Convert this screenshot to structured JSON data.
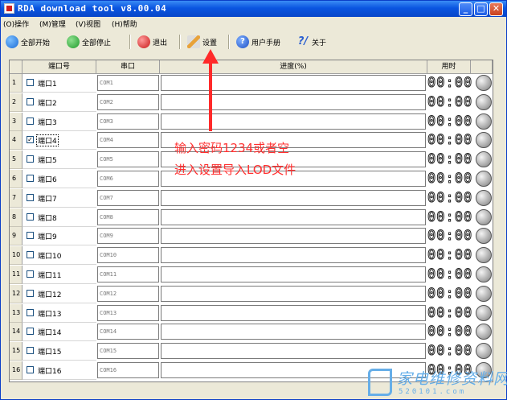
{
  "window": {
    "title": "RDA download tool v8.00.04",
    "min_glyph": "_",
    "max_glyph": "□",
    "close_glyph": "✕"
  },
  "menu": [
    {
      "label": "(O)操作"
    },
    {
      "label": "(M)管理"
    },
    {
      "label": "(V)视图"
    },
    {
      "label": "(H)帮助"
    }
  ],
  "toolbar": {
    "start_all": "全部开始",
    "stop_all": "全部停止",
    "exit": "退出",
    "settings": "设置",
    "manual": "用户手册",
    "about": "关于"
  },
  "grid": {
    "headers": {
      "port": "端口号",
      "serial": "串口",
      "progress": "进度(%)",
      "time": "用时"
    },
    "rows": [
      {
        "num": "1",
        "port": "端口1",
        "com": "COM1",
        "time": "00:00",
        "checked": false
      },
      {
        "num": "2",
        "port": "端口2",
        "com": "COM2",
        "time": "00:00",
        "checked": false
      },
      {
        "num": "3",
        "port": "端口3",
        "com": "COM3",
        "time": "00:00",
        "checked": false
      },
      {
        "num": "4",
        "port": "端口4",
        "com": "COM4",
        "time": "00:00",
        "checked": true
      },
      {
        "num": "5",
        "port": "端口5",
        "com": "COM5",
        "time": "00:00",
        "checked": false
      },
      {
        "num": "6",
        "port": "端口6",
        "com": "COM6",
        "time": "00:00",
        "checked": false
      },
      {
        "num": "7",
        "port": "端口7",
        "com": "COM7",
        "time": "00:00",
        "checked": false
      },
      {
        "num": "8",
        "port": "端口8",
        "com": "COM8",
        "time": "00:00",
        "checked": false
      },
      {
        "num": "9",
        "port": "端口9",
        "com": "COM9",
        "time": "00:00",
        "checked": false
      },
      {
        "num": "10",
        "port": "端口10",
        "com": "COM10",
        "time": "00:00",
        "checked": false
      },
      {
        "num": "11",
        "port": "端口11",
        "com": "COM11",
        "time": "00:00",
        "checked": false
      },
      {
        "num": "12",
        "port": "端口12",
        "com": "COM12",
        "time": "00:00",
        "checked": false
      },
      {
        "num": "13",
        "port": "端口13",
        "com": "COM13",
        "time": "00:00",
        "checked": false
      },
      {
        "num": "14",
        "port": "端口14",
        "com": "COM14",
        "time": "00:00",
        "checked": false
      },
      {
        "num": "15",
        "port": "端口15",
        "com": "COM15",
        "time": "00:00",
        "checked": false
      },
      {
        "num": "16",
        "port": "端口16",
        "com": "COM16",
        "time": "00:00",
        "checked": false
      }
    ]
  },
  "annotation": {
    "line1": "输入密码1234或者空",
    "line2": "进入设置导入LOD文件",
    "color": "#ff3030"
  },
  "watermark": {
    "text": "家电维修资料网",
    "url": "520101.com"
  },
  "colors": {
    "title_bar": "#0a55e0",
    "chrome": "#ece9d8",
    "annotation": "#ff3030"
  }
}
